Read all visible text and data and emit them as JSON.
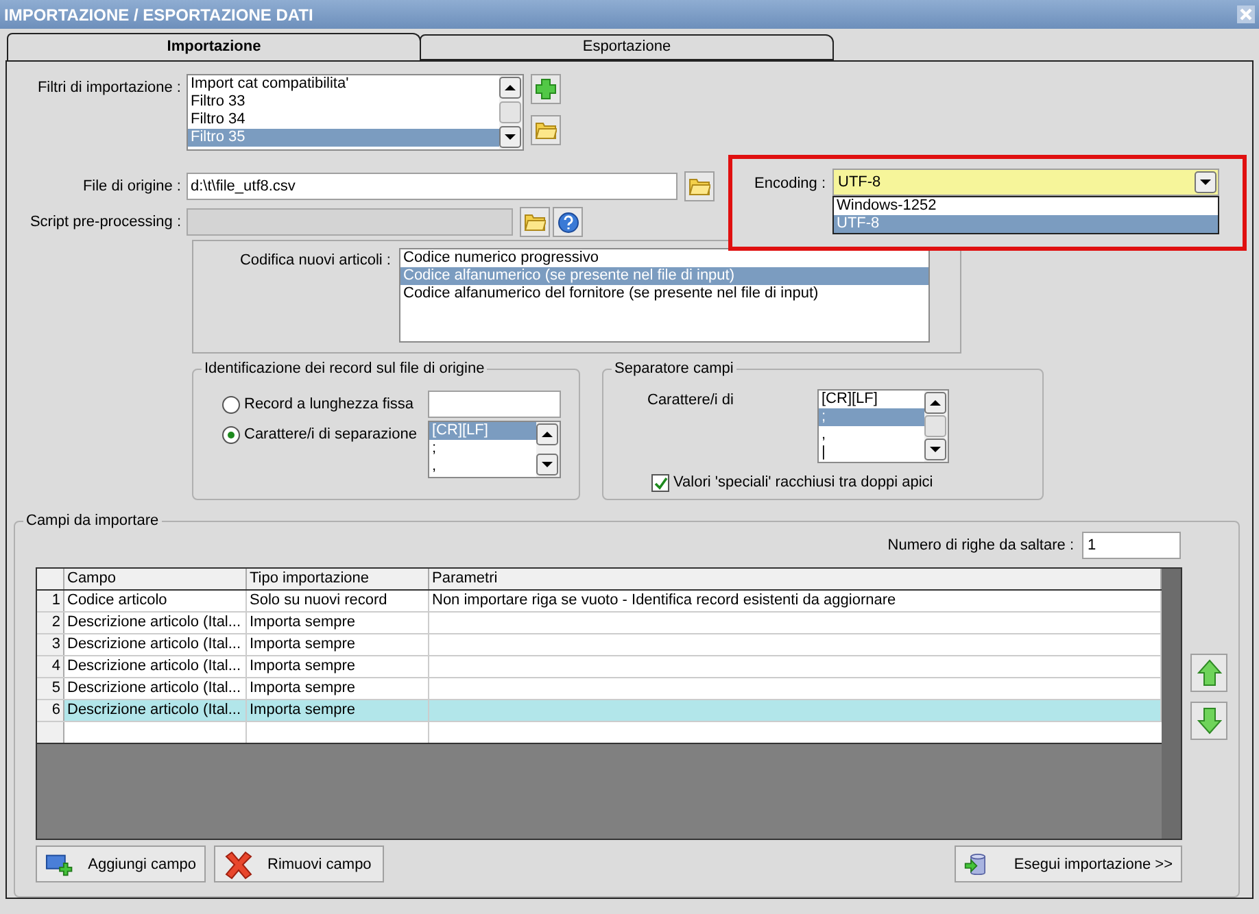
{
  "window": {
    "title": "IMPORTAZIONE / ESPORTAZIONE DATI"
  },
  "tabs": [
    {
      "label": "Importazione",
      "selected": true
    },
    {
      "label": "Esportazione",
      "selected": false
    }
  ],
  "filters": {
    "label": "Filtri di importazione :",
    "items": [
      {
        "label": "Import cat compatibilita'",
        "selected": false
      },
      {
        "label": "Filtro 33",
        "selected": false
      },
      {
        "label": "Filtro 34",
        "selected": false
      },
      {
        "label": "Filtro 35",
        "selected": true
      }
    ]
  },
  "source_file": {
    "label": "File di origine :",
    "value": "d:\\t\\file_utf8.csv"
  },
  "encoding": {
    "label": "Encoding :",
    "value": "UTF-8",
    "expanded": true,
    "options": [
      {
        "label": "Windows-1252",
        "selected": false
      },
      {
        "label": "UTF-8",
        "selected": true
      }
    ]
  },
  "script": {
    "label": "Script pre-processing :",
    "disabled": true
  },
  "new_item_coding": {
    "label": "Codifica nuovi articoli :",
    "items": [
      {
        "label": "Codice numerico progressivo",
        "selected": false
      },
      {
        "label": "Codice alfanumerico (se presente nel file di input)",
        "selected": true
      },
      {
        "label": "Codice alfanumerico del fornitore (se presente nel file di input)",
        "selected": false
      }
    ]
  },
  "record_identification": {
    "title": "Identificazione dei record sul file di origine",
    "options": [
      {
        "label": "Record a lunghezza fissa",
        "selected": false
      },
      {
        "label": "Carattere/i di separazione",
        "selected": true
      }
    ],
    "separators": [
      {
        "label": "[CR][LF]",
        "selected": true
      },
      {
        "label": ";",
        "selected": false
      },
      {
        "label": ",",
        "selected": false
      }
    ]
  },
  "field_separator": {
    "title": "Separatore campi",
    "label": "Carattere/i di",
    "items": [
      {
        "label": "[CR][LF]",
        "selected": false
      },
      {
        "label": ";",
        "selected": true
      },
      {
        "label": ",",
        "selected": false
      },
      {
        "label": "|",
        "selected": false
      }
    ],
    "quoted_special": {
      "label": "Valori 'speciali' racchiusi tra doppi apici",
      "checked": true
    }
  },
  "fields": {
    "title": "Campi da importare",
    "skip_rows": {
      "label": "Numero di righe da saltare :",
      "value": "1"
    },
    "columns": [
      "Campo",
      "Tipo importazione",
      "Parametri"
    ],
    "rows": [
      {
        "number": "1",
        "cells": [
          "Codice articolo",
          "Solo su nuovi record",
          "Non importare riga se vuoto - Identifica record esistenti da aggiornare"
        ],
        "selected": false
      },
      {
        "number": "2",
        "cells": [
          "Descrizione articolo (Ital...",
          "Importa sempre",
          ""
        ],
        "selected": false
      },
      {
        "number": "3",
        "cells": [
          "Descrizione articolo (Ital...",
          "Importa sempre",
          ""
        ],
        "selected": false
      },
      {
        "number": "4",
        "cells": [
          "Descrizione articolo (Ital...",
          "Importa sempre",
          ""
        ],
        "selected": false
      },
      {
        "number": "5",
        "cells": [
          "Descrizione articolo (Ital...",
          "Importa sempre",
          ""
        ],
        "selected": false
      },
      {
        "number": "6",
        "cells": [
          "Descrizione articolo (Ital...",
          "Importa sempre",
          ""
        ],
        "selected": true
      }
    ]
  },
  "buttons": [
    {
      "kind": "add",
      "label": "Aggiungi campo"
    },
    {
      "kind": "remove",
      "label": "Rimuovi campo"
    },
    {
      "kind": "run",
      "label": "Esegui importazione >>"
    }
  ]
}
